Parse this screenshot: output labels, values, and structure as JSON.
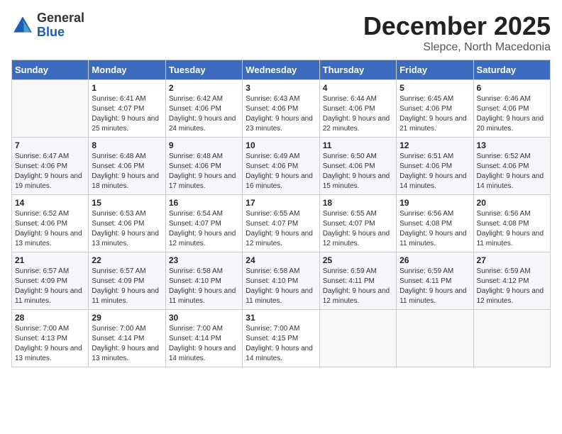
{
  "header": {
    "logo_general": "General",
    "logo_blue": "Blue",
    "month": "December 2025",
    "location": "Slepce, North Macedonia"
  },
  "days_of_week": [
    "Sunday",
    "Monday",
    "Tuesday",
    "Wednesday",
    "Thursday",
    "Friday",
    "Saturday"
  ],
  "weeks": [
    [
      {
        "day": "",
        "sunrise": "",
        "sunset": "",
        "daylight": ""
      },
      {
        "day": "1",
        "sunrise": "Sunrise: 6:41 AM",
        "sunset": "Sunset: 4:07 PM",
        "daylight": "Daylight: 9 hours and 25 minutes."
      },
      {
        "day": "2",
        "sunrise": "Sunrise: 6:42 AM",
        "sunset": "Sunset: 4:06 PM",
        "daylight": "Daylight: 9 hours and 24 minutes."
      },
      {
        "day": "3",
        "sunrise": "Sunrise: 6:43 AM",
        "sunset": "Sunset: 4:06 PM",
        "daylight": "Daylight: 9 hours and 23 minutes."
      },
      {
        "day": "4",
        "sunrise": "Sunrise: 6:44 AM",
        "sunset": "Sunset: 4:06 PM",
        "daylight": "Daylight: 9 hours and 22 minutes."
      },
      {
        "day": "5",
        "sunrise": "Sunrise: 6:45 AM",
        "sunset": "Sunset: 4:06 PM",
        "daylight": "Daylight: 9 hours and 21 minutes."
      },
      {
        "day": "6",
        "sunrise": "Sunrise: 6:46 AM",
        "sunset": "Sunset: 4:06 PM",
        "daylight": "Daylight: 9 hours and 20 minutes."
      }
    ],
    [
      {
        "day": "7",
        "sunrise": "Sunrise: 6:47 AM",
        "sunset": "Sunset: 4:06 PM",
        "daylight": "Daylight: 9 hours and 19 minutes."
      },
      {
        "day": "8",
        "sunrise": "Sunrise: 6:48 AM",
        "sunset": "Sunset: 4:06 PM",
        "daylight": "Daylight: 9 hours and 18 minutes."
      },
      {
        "day": "9",
        "sunrise": "Sunrise: 6:48 AM",
        "sunset": "Sunset: 4:06 PM",
        "daylight": "Daylight: 9 hours and 17 minutes."
      },
      {
        "day": "10",
        "sunrise": "Sunrise: 6:49 AM",
        "sunset": "Sunset: 4:06 PM",
        "daylight": "Daylight: 9 hours and 16 minutes."
      },
      {
        "day": "11",
        "sunrise": "Sunrise: 6:50 AM",
        "sunset": "Sunset: 4:06 PM",
        "daylight": "Daylight: 9 hours and 15 minutes."
      },
      {
        "day": "12",
        "sunrise": "Sunrise: 6:51 AM",
        "sunset": "Sunset: 4:06 PM",
        "daylight": "Daylight: 9 hours and 14 minutes."
      },
      {
        "day": "13",
        "sunrise": "Sunrise: 6:52 AM",
        "sunset": "Sunset: 4:06 PM",
        "daylight": "Daylight: 9 hours and 14 minutes."
      }
    ],
    [
      {
        "day": "14",
        "sunrise": "Sunrise: 6:52 AM",
        "sunset": "Sunset: 4:06 PM",
        "daylight": "Daylight: 9 hours and 13 minutes."
      },
      {
        "day": "15",
        "sunrise": "Sunrise: 6:53 AM",
        "sunset": "Sunset: 4:06 PM",
        "daylight": "Daylight: 9 hours and 13 minutes."
      },
      {
        "day": "16",
        "sunrise": "Sunrise: 6:54 AM",
        "sunset": "Sunset: 4:07 PM",
        "daylight": "Daylight: 9 hours and 12 minutes."
      },
      {
        "day": "17",
        "sunrise": "Sunrise: 6:55 AM",
        "sunset": "Sunset: 4:07 PM",
        "daylight": "Daylight: 9 hours and 12 minutes."
      },
      {
        "day": "18",
        "sunrise": "Sunrise: 6:55 AM",
        "sunset": "Sunset: 4:07 PM",
        "daylight": "Daylight: 9 hours and 12 minutes."
      },
      {
        "day": "19",
        "sunrise": "Sunrise: 6:56 AM",
        "sunset": "Sunset: 4:08 PM",
        "daylight": "Daylight: 9 hours and 11 minutes."
      },
      {
        "day": "20",
        "sunrise": "Sunrise: 6:56 AM",
        "sunset": "Sunset: 4:08 PM",
        "daylight": "Daylight: 9 hours and 11 minutes."
      }
    ],
    [
      {
        "day": "21",
        "sunrise": "Sunrise: 6:57 AM",
        "sunset": "Sunset: 4:09 PM",
        "daylight": "Daylight: 9 hours and 11 minutes."
      },
      {
        "day": "22",
        "sunrise": "Sunrise: 6:57 AM",
        "sunset": "Sunset: 4:09 PM",
        "daylight": "Daylight: 9 hours and 11 minutes."
      },
      {
        "day": "23",
        "sunrise": "Sunrise: 6:58 AM",
        "sunset": "Sunset: 4:10 PM",
        "daylight": "Daylight: 9 hours and 11 minutes."
      },
      {
        "day": "24",
        "sunrise": "Sunrise: 6:58 AM",
        "sunset": "Sunset: 4:10 PM",
        "daylight": "Daylight: 9 hours and 11 minutes."
      },
      {
        "day": "25",
        "sunrise": "Sunrise: 6:59 AM",
        "sunset": "Sunset: 4:11 PM",
        "daylight": "Daylight: 9 hours and 12 minutes."
      },
      {
        "day": "26",
        "sunrise": "Sunrise: 6:59 AM",
        "sunset": "Sunset: 4:11 PM",
        "daylight": "Daylight: 9 hours and 11 minutes."
      },
      {
        "day": "27",
        "sunrise": "Sunrise: 6:59 AM",
        "sunset": "Sunset: 4:12 PM",
        "daylight": "Daylight: 9 hours and 12 minutes."
      }
    ],
    [
      {
        "day": "28",
        "sunrise": "Sunrise: 7:00 AM",
        "sunset": "Sunset: 4:13 PM",
        "daylight": "Daylight: 9 hours and 13 minutes."
      },
      {
        "day": "29",
        "sunrise": "Sunrise: 7:00 AM",
        "sunset": "Sunset: 4:14 PM",
        "daylight": "Daylight: 9 hours and 13 minutes."
      },
      {
        "day": "30",
        "sunrise": "Sunrise: 7:00 AM",
        "sunset": "Sunset: 4:14 PM",
        "daylight": "Daylight: 9 hours and 14 minutes."
      },
      {
        "day": "31",
        "sunrise": "Sunrise: 7:00 AM",
        "sunset": "Sunset: 4:15 PM",
        "daylight": "Daylight: 9 hours and 14 minutes."
      },
      {
        "day": "",
        "sunrise": "",
        "sunset": "",
        "daylight": ""
      },
      {
        "day": "",
        "sunrise": "",
        "sunset": "",
        "daylight": ""
      },
      {
        "day": "",
        "sunrise": "",
        "sunset": "",
        "daylight": ""
      }
    ]
  ]
}
